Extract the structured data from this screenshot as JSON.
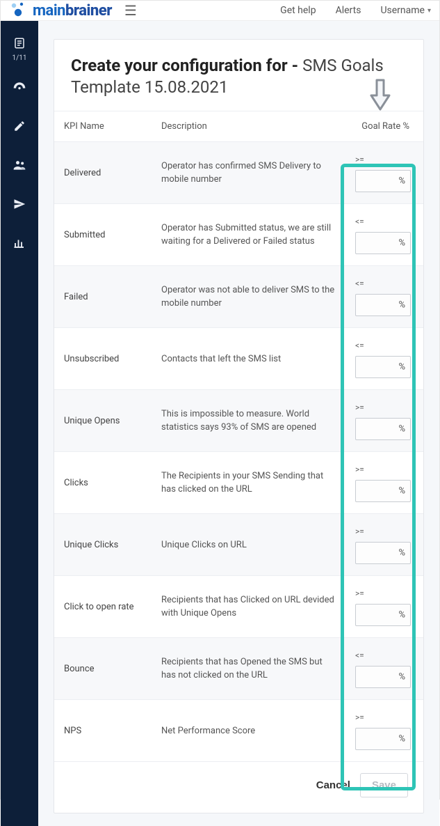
{
  "header": {
    "brand_main": "main",
    "brand_accent": "brainer",
    "get_help": "Get help",
    "alerts": "Alerts",
    "username": "Username"
  },
  "sidebar": {
    "counter": "1/11"
  },
  "page": {
    "title_prefix": "Create your configuration for - ",
    "title_suffix": "SMS Goals Template 15.08.2021"
  },
  "table": {
    "col_kpi": "KPI Name",
    "col_desc": "Description",
    "col_goal": "Goal Rate %",
    "percent_sign": "%",
    "rows": [
      {
        "kpi": "Delivered",
        "desc": "Operator has confirmed SMS Delivery to mobile number",
        "op": ">="
      },
      {
        "kpi": "Submitted",
        "desc": "Operator has Submitted status, we are still waiting for a Delivered or Failed status",
        "op": "<="
      },
      {
        "kpi": "Failed",
        "desc": "Operator was not able to deliver SMS to the mobile number",
        "op": "<="
      },
      {
        "kpi": "Unsubscribed",
        "desc": "Contacts that left the SMS list",
        "op": "<="
      },
      {
        "kpi": "Unique Opens",
        "desc": "This is impossible to measure. World statistics says 93% of SMS are opened",
        "op": ">="
      },
      {
        "kpi": "Clicks",
        "desc": "The Recipients in your SMS Sending that has clicked on the URL",
        "op": ">="
      },
      {
        "kpi": "Unique Clicks",
        "desc": "Unique Clicks on URL",
        "op": ">="
      },
      {
        "kpi": "Click to open rate",
        "desc": "Recipients that has Clicked on URL devided with Unique Opens",
        "op": ">="
      },
      {
        "kpi": "Bounce",
        "desc": "Recipients that has Opened the SMS but has not clicked on the URL",
        "op": "<="
      },
      {
        "kpi": "NPS",
        "desc": "Net Performance Score",
        "op": ">="
      }
    ]
  },
  "buttons": {
    "cancel": "Cancel",
    "save": "Save"
  },
  "colors": {
    "highlight": "#2ec4b6",
    "sidebar_bg": "#0d1f39",
    "brand_blue": "#1565c0"
  }
}
